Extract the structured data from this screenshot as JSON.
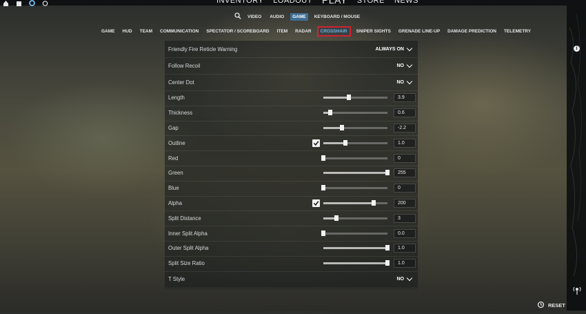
{
  "main_nav": [
    "INVENTORY",
    "LOADOUT",
    "PLAY",
    "STORE",
    "NEWS"
  ],
  "settings_tabs": [
    {
      "label": "VIDEO",
      "active": false
    },
    {
      "label": "AUDIO",
      "active": false
    },
    {
      "label": "GAME",
      "active": true
    },
    {
      "label": "KEYBOARD / MOUSE",
      "active": false
    }
  ],
  "game_tabs": [
    {
      "label": "GAME",
      "active": false
    },
    {
      "label": "HUD",
      "active": false
    },
    {
      "label": "TEAM",
      "active": false
    },
    {
      "label": "COMMUNICATION",
      "active": false
    },
    {
      "label": "SPECTATOR / SCOREBOARD",
      "active": false
    },
    {
      "label": "ITEM",
      "active": false
    },
    {
      "label": "RADAR",
      "active": false
    },
    {
      "label": "CROSSHAIR",
      "active": true
    },
    {
      "label": "SNIPER SIGHTS",
      "active": false
    },
    {
      "label": "GRENADE LINE-UP",
      "active": false
    },
    {
      "label": "DAMAGE PREDICTION",
      "active": false
    },
    {
      "label": "TELEMETRY",
      "active": false
    }
  ],
  "settings": [
    {
      "label": "Friendly Fire Reticle Warning",
      "type": "dropdown",
      "value": "ALWAYS ON"
    },
    {
      "label": "Follow Recoil",
      "type": "dropdown",
      "value": "NO"
    },
    {
      "label": "Center Dot",
      "type": "dropdown",
      "value": "NO"
    },
    {
      "label": "Length",
      "type": "slider",
      "value": "3.9",
      "fraction": 0.4
    },
    {
      "label": "Thickness",
      "type": "slider",
      "value": "0.6",
      "fraction": 0.11
    },
    {
      "label": "Gap",
      "type": "slider",
      "value": "-2.2",
      "fraction": 0.29
    },
    {
      "label": "Outline",
      "type": "slider",
      "value": "1.0",
      "fraction": 0.34,
      "checkbox": true
    },
    {
      "label": "Red",
      "type": "slider",
      "value": "0",
      "fraction": 0.0
    },
    {
      "label": "Green",
      "type": "slider",
      "value": "255",
      "fraction": 1.0
    },
    {
      "label": "Blue",
      "type": "slider",
      "value": "0",
      "fraction": 0.0
    },
    {
      "label": "Alpha",
      "type": "slider",
      "value": "200",
      "fraction": 0.78,
      "checkbox": true
    },
    {
      "label": "Split Distance",
      "type": "slider",
      "value": "3",
      "fraction": 0.2
    },
    {
      "label": "Inner Split Alpha",
      "type": "slider",
      "value": "0.0",
      "fraction": 0.0
    },
    {
      "label": "Outer Split Alpha",
      "type": "slider",
      "value": "1.0",
      "fraction": 1.0
    },
    {
      "label": "Split Size Ratio",
      "type": "slider",
      "value": "1.0",
      "fraction": 1.0
    },
    {
      "label": "T Style",
      "type": "dropdown",
      "value": "NO"
    }
  ],
  "reset_label": "RESET",
  "colors": {
    "active_tab": "#3f6e95",
    "highlight_box": "#d1232f",
    "active_tab_text": "#6fb1e0"
  }
}
